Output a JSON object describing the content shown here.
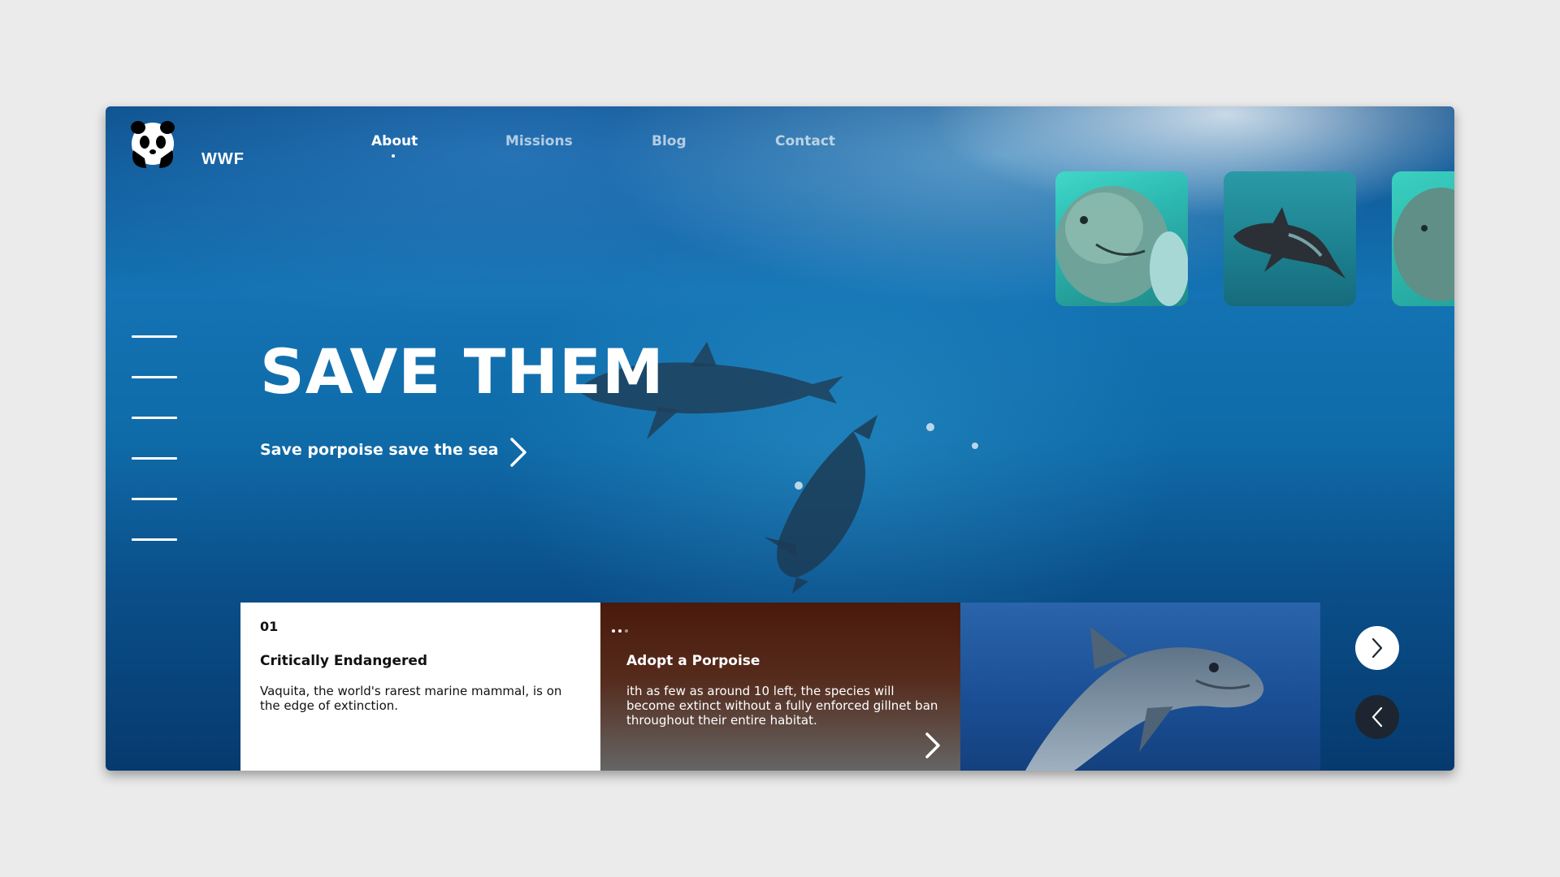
{
  "brand": {
    "name": "WWF"
  },
  "nav": {
    "items": [
      {
        "label": "About",
        "active": true
      },
      {
        "label": "Missions",
        "active": false
      },
      {
        "label": "Blog",
        "active": false
      },
      {
        "label": "Contact",
        "active": false
      }
    ]
  },
  "hero": {
    "title": "SAVE THEM",
    "subtitle": "Save porpoise save the sea"
  },
  "cards": [
    {
      "number": "01",
      "title": "Critically  Endangered",
      "text": "Vaquita, the world's rarest marine mammal, is on the edge of extinction."
    },
    {
      "title": "Adopt a Porpoise",
      "text": "ith as few as around 10 left, the species will become extinct without a fully enforced gillnet ban throughout their entire habitat."
    }
  ],
  "colors": {
    "page_background": "#ebebeb",
    "ocean_blue": "#1473b4",
    "card_brown": "#4a1a0c",
    "prev_button": "#1d2530"
  },
  "icons": [
    "wwf-panda-icon",
    "chevron-right-icon",
    "chevron-left-icon",
    "more-dots-icon",
    "menu-line-icon"
  ]
}
